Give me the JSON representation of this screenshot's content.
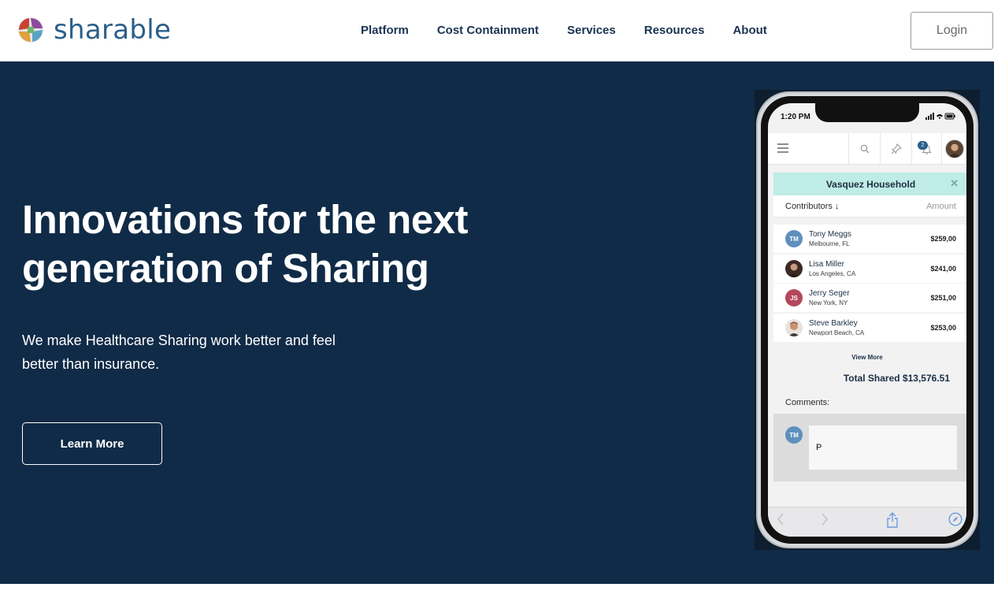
{
  "nav": {
    "logo_text": "sharable",
    "items": [
      "Platform",
      "Cost Containment",
      "Services",
      "Resources",
      "About"
    ],
    "login_label": "Login"
  },
  "hero": {
    "title": "Innovations for the next generation of Sharing",
    "subtitle": "We make Healthcare Sharing work better and feel better than insurance.",
    "cta_label": "Learn More"
  },
  "phone": {
    "status_time": "1:20 PM",
    "notification_count": "2",
    "household_title": "Vasquez Household",
    "close_glyph": "✕",
    "columns": {
      "contributors": "Contributors ↓",
      "amount": "Amount"
    },
    "contributors": [
      {
        "initials": "TM",
        "name": "Tony Meggs",
        "location": "Melbourne, FL",
        "amount": "$259,00",
        "avatar_color": "#5f8fbd"
      },
      {
        "initials": "",
        "name": "Lisa Miller",
        "location": "Los Angeles, CA",
        "amount": "$241,00",
        "avatar_color": "#3b2a24"
      },
      {
        "initials": "JS",
        "name": "Jerry Seger",
        "location": "New York, NY",
        "amount": "$251,00",
        "avatar_color": "#b4475b"
      },
      {
        "initials": "",
        "name": "Steve Barkley",
        "location": "Newport Beach, CA",
        "amount": "$253,00",
        "avatar_color": "#a07256"
      }
    ],
    "view_more": "View More",
    "total_shared": "Total Shared $13,576.51",
    "comments_label": "Comments:",
    "comment_initials": "TM",
    "comment_value": "P"
  },
  "icons": {
    "menu": "hamburger-icon",
    "search": "search-icon",
    "pin": "pin-icon",
    "bell": "bell-icon",
    "back": "chevron-left-icon",
    "forward": "chevron-right-icon",
    "share": "share-icon",
    "compass": "compass-icon"
  },
  "colors": {
    "hero_bg": "#102b47",
    "brand_blue": "#2b5f8a",
    "household_bg": "#bfece6"
  }
}
